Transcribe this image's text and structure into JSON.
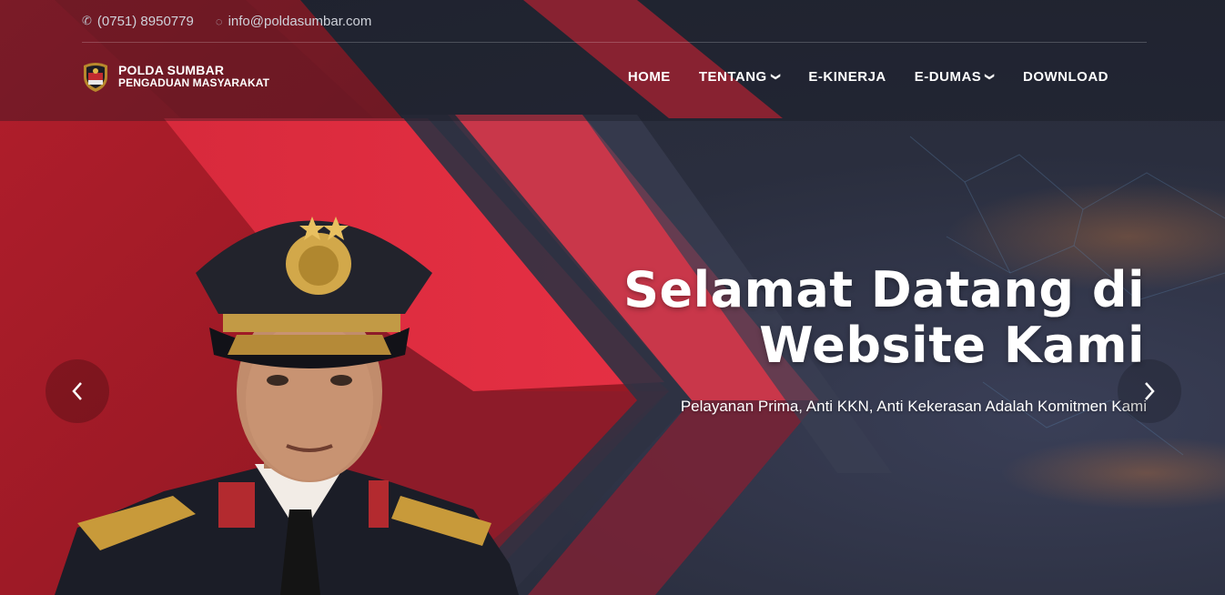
{
  "topbar": {
    "phone_icon": "phone-icon",
    "phone": "(0751) 8950779",
    "email_icon": "email-icon",
    "email": "info@poldasumbar.com"
  },
  "brand": {
    "title": "POLDA SUMBAR",
    "subtitle": "PENGADUAN MASYARAKAT"
  },
  "nav": {
    "items": [
      {
        "label": "HOME",
        "dropdown": false
      },
      {
        "label": "TENTANG",
        "dropdown": true
      },
      {
        "label": "E-KINERJA",
        "dropdown": false
      },
      {
        "label": "E-DUMAS",
        "dropdown": true
      },
      {
        "label": "DOWNLOAD",
        "dropdown": false
      }
    ]
  },
  "hero": {
    "title_line1": "Selamat Datang di",
    "title_line2": "Website Kami",
    "subtitle": "Pelayanan Prima, Anti KKN, Anti Kekerasan Adalah Komitmen Kami",
    "prev_icon": "chevron-left-icon",
    "next_icon": "chevron-right-icon"
  },
  "colors": {
    "accent_red": "#e0283d",
    "dark_red": "#a01824",
    "bg_dark": "#2b2f3d",
    "text_white": "#ffffff"
  }
}
